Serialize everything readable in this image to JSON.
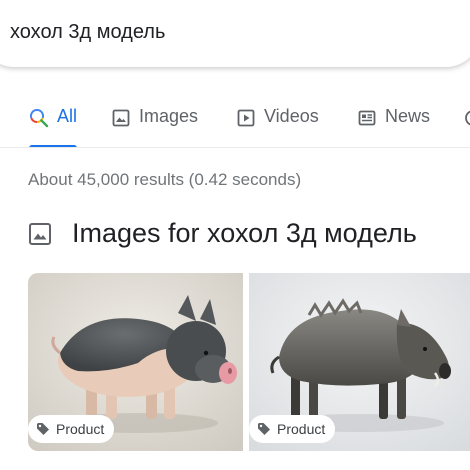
{
  "search": {
    "query": "хохол 3д модель"
  },
  "tabs": [
    {
      "label": "All",
      "icon": "search-icon",
      "active": true
    },
    {
      "label": "Images",
      "icon": "image-icon"
    },
    {
      "label": "Videos",
      "icon": "play-icon"
    },
    {
      "label": "News",
      "icon": "newspaper-icon"
    }
  ],
  "results": {
    "stats": "About 45,000 results (0.42 seconds)"
  },
  "images_section": {
    "title": "Images for хохол 3д модель",
    "items": [
      {
        "badge": "Product",
        "subject": "pig-3d-model"
      },
      {
        "badge": "Product",
        "subject": "boar-3d-model"
      }
    ]
  },
  "colors": {
    "accent": "#1a73e8",
    "text": "#202124",
    "muted": "#70757a",
    "google_blue": "#4285f4",
    "google_red": "#ea4335",
    "google_yellow": "#fbbc05",
    "google_green": "#34a853"
  }
}
